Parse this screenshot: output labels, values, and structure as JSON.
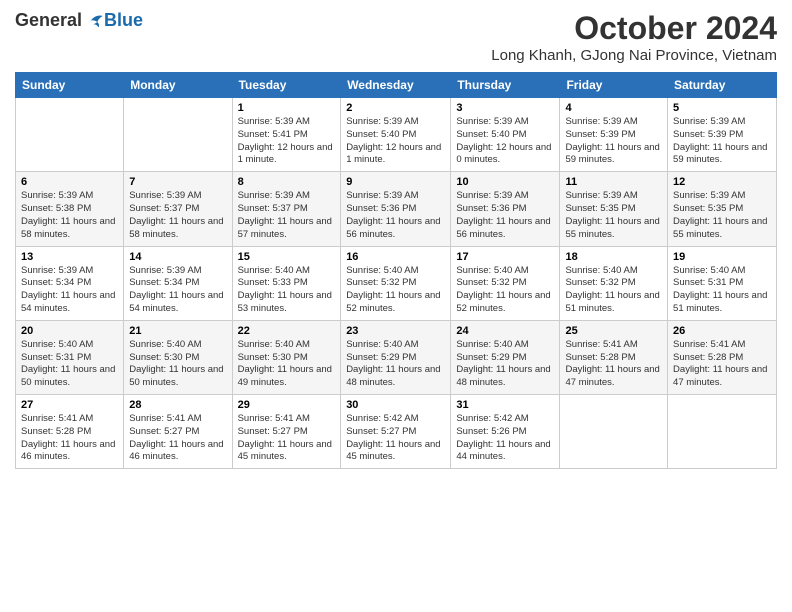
{
  "header": {
    "logo_general": "General",
    "logo_blue": "Blue",
    "month": "October 2024",
    "location": "Long Khanh, GJong Nai Province, Vietnam"
  },
  "weekdays": [
    "Sunday",
    "Monday",
    "Tuesday",
    "Wednesday",
    "Thursday",
    "Friday",
    "Saturday"
  ],
  "weeks": [
    [
      {
        "day": "",
        "sunrise": "",
        "sunset": "",
        "daylight": ""
      },
      {
        "day": "",
        "sunrise": "",
        "sunset": "",
        "daylight": ""
      },
      {
        "day": "1",
        "sunrise": "Sunrise: 5:39 AM",
        "sunset": "Sunset: 5:41 PM",
        "daylight": "Daylight: 12 hours and 1 minute."
      },
      {
        "day": "2",
        "sunrise": "Sunrise: 5:39 AM",
        "sunset": "Sunset: 5:40 PM",
        "daylight": "Daylight: 12 hours and 1 minute."
      },
      {
        "day": "3",
        "sunrise": "Sunrise: 5:39 AM",
        "sunset": "Sunset: 5:40 PM",
        "daylight": "Daylight: 12 hours and 0 minutes."
      },
      {
        "day": "4",
        "sunrise": "Sunrise: 5:39 AM",
        "sunset": "Sunset: 5:39 PM",
        "daylight": "Daylight: 11 hours and 59 minutes."
      },
      {
        "day": "5",
        "sunrise": "Sunrise: 5:39 AM",
        "sunset": "Sunset: 5:39 PM",
        "daylight": "Daylight: 11 hours and 59 minutes."
      }
    ],
    [
      {
        "day": "6",
        "sunrise": "Sunrise: 5:39 AM",
        "sunset": "Sunset: 5:38 PM",
        "daylight": "Daylight: 11 hours and 58 minutes."
      },
      {
        "day": "7",
        "sunrise": "Sunrise: 5:39 AM",
        "sunset": "Sunset: 5:37 PM",
        "daylight": "Daylight: 11 hours and 58 minutes."
      },
      {
        "day": "8",
        "sunrise": "Sunrise: 5:39 AM",
        "sunset": "Sunset: 5:37 PM",
        "daylight": "Daylight: 11 hours and 57 minutes."
      },
      {
        "day": "9",
        "sunrise": "Sunrise: 5:39 AM",
        "sunset": "Sunset: 5:36 PM",
        "daylight": "Daylight: 11 hours and 56 minutes."
      },
      {
        "day": "10",
        "sunrise": "Sunrise: 5:39 AM",
        "sunset": "Sunset: 5:36 PM",
        "daylight": "Daylight: 11 hours and 56 minutes."
      },
      {
        "day": "11",
        "sunrise": "Sunrise: 5:39 AM",
        "sunset": "Sunset: 5:35 PM",
        "daylight": "Daylight: 11 hours and 55 minutes."
      },
      {
        "day": "12",
        "sunrise": "Sunrise: 5:39 AM",
        "sunset": "Sunset: 5:35 PM",
        "daylight": "Daylight: 11 hours and 55 minutes."
      }
    ],
    [
      {
        "day": "13",
        "sunrise": "Sunrise: 5:39 AM",
        "sunset": "Sunset: 5:34 PM",
        "daylight": "Daylight: 11 hours and 54 minutes."
      },
      {
        "day": "14",
        "sunrise": "Sunrise: 5:39 AM",
        "sunset": "Sunset: 5:34 PM",
        "daylight": "Daylight: 11 hours and 54 minutes."
      },
      {
        "day": "15",
        "sunrise": "Sunrise: 5:40 AM",
        "sunset": "Sunset: 5:33 PM",
        "daylight": "Daylight: 11 hours and 53 minutes."
      },
      {
        "day": "16",
        "sunrise": "Sunrise: 5:40 AM",
        "sunset": "Sunset: 5:32 PM",
        "daylight": "Daylight: 11 hours and 52 minutes."
      },
      {
        "day": "17",
        "sunrise": "Sunrise: 5:40 AM",
        "sunset": "Sunset: 5:32 PM",
        "daylight": "Daylight: 11 hours and 52 minutes."
      },
      {
        "day": "18",
        "sunrise": "Sunrise: 5:40 AM",
        "sunset": "Sunset: 5:32 PM",
        "daylight": "Daylight: 11 hours and 51 minutes."
      },
      {
        "day": "19",
        "sunrise": "Sunrise: 5:40 AM",
        "sunset": "Sunset: 5:31 PM",
        "daylight": "Daylight: 11 hours and 51 minutes."
      }
    ],
    [
      {
        "day": "20",
        "sunrise": "Sunrise: 5:40 AM",
        "sunset": "Sunset: 5:31 PM",
        "daylight": "Daylight: 11 hours and 50 minutes."
      },
      {
        "day": "21",
        "sunrise": "Sunrise: 5:40 AM",
        "sunset": "Sunset: 5:30 PM",
        "daylight": "Daylight: 11 hours and 50 minutes."
      },
      {
        "day": "22",
        "sunrise": "Sunrise: 5:40 AM",
        "sunset": "Sunset: 5:30 PM",
        "daylight": "Daylight: 11 hours and 49 minutes."
      },
      {
        "day": "23",
        "sunrise": "Sunrise: 5:40 AM",
        "sunset": "Sunset: 5:29 PM",
        "daylight": "Daylight: 11 hours and 48 minutes."
      },
      {
        "day": "24",
        "sunrise": "Sunrise: 5:40 AM",
        "sunset": "Sunset: 5:29 PM",
        "daylight": "Daylight: 11 hours and 48 minutes."
      },
      {
        "day": "25",
        "sunrise": "Sunrise: 5:41 AM",
        "sunset": "Sunset: 5:28 PM",
        "daylight": "Daylight: 11 hours and 47 minutes."
      },
      {
        "day": "26",
        "sunrise": "Sunrise: 5:41 AM",
        "sunset": "Sunset: 5:28 PM",
        "daylight": "Daylight: 11 hours and 47 minutes."
      }
    ],
    [
      {
        "day": "27",
        "sunrise": "Sunrise: 5:41 AM",
        "sunset": "Sunset: 5:28 PM",
        "daylight": "Daylight: 11 hours and 46 minutes."
      },
      {
        "day": "28",
        "sunrise": "Sunrise: 5:41 AM",
        "sunset": "Sunset: 5:27 PM",
        "daylight": "Daylight: 11 hours and 46 minutes."
      },
      {
        "day": "29",
        "sunrise": "Sunrise: 5:41 AM",
        "sunset": "Sunset: 5:27 PM",
        "daylight": "Daylight: 11 hours and 45 minutes."
      },
      {
        "day": "30",
        "sunrise": "Sunrise: 5:42 AM",
        "sunset": "Sunset: 5:27 PM",
        "daylight": "Daylight: 11 hours and 45 minutes."
      },
      {
        "day": "31",
        "sunrise": "Sunrise: 5:42 AM",
        "sunset": "Sunset: 5:26 PM",
        "daylight": "Daylight: 11 hours and 44 minutes."
      },
      {
        "day": "",
        "sunrise": "",
        "sunset": "",
        "daylight": ""
      },
      {
        "day": "",
        "sunrise": "",
        "sunset": "",
        "daylight": ""
      }
    ]
  ]
}
